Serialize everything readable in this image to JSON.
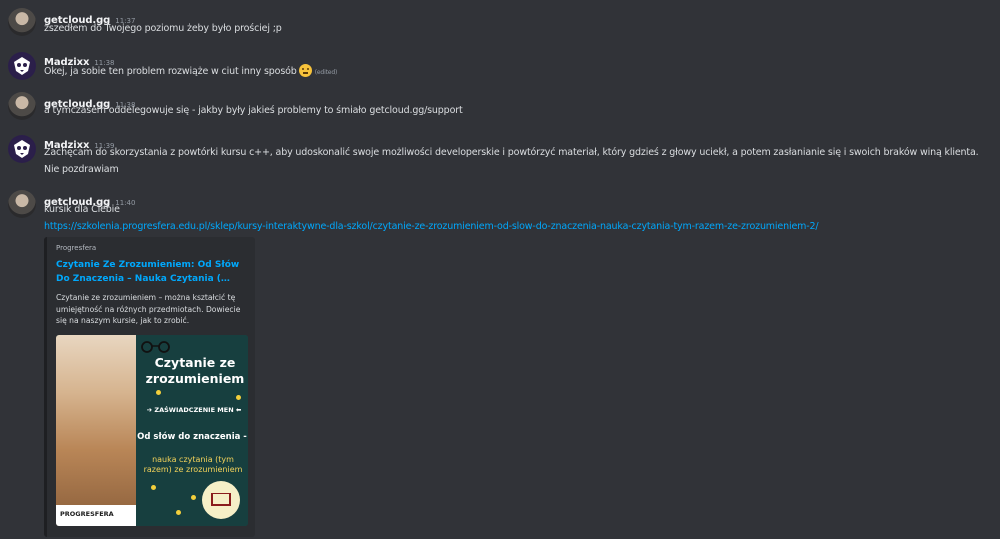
{
  "messages": [
    {
      "user": "getcloud.gg",
      "time": "11:37",
      "lines": [
        "zszedłem do Twojego poziomu żeby było prościej ;p"
      ]
    },
    {
      "user": "Madzixx",
      "time": "11:38",
      "lines": [
        "Okej, ja sobie ten problem rozwiąże w ciut inny sposób"
      ],
      "edited": "(edited)"
    },
    {
      "user": "getcloud.gg",
      "time": "11:38",
      "lines": [
        "a tymczasem oddelegowuje się - jakby były jakieś problemy to śmiało getcloud.gg/support"
      ]
    },
    {
      "user": "Madzixx",
      "time": "11:39",
      "lines": [
        "Zachęcam do skorzystania z powtórki kursu c++, aby udoskonalić swoje możliwości developerskie i powtórzyć materiał, który gdzieś z głowy uciekł, a potem zasłanianie się i swoich braków winą klienta.",
        "Nie pozdrawiam"
      ]
    },
    {
      "user": "getcloud.gg",
      "time": "11:40",
      "lines": [
        "kursik dla Ciebie"
      ],
      "link": "https://szkolenia.progresfera.edu.pl/sklep/kursy-interaktywne-dla-szkol/czytanie-ze-zrozumieniem-od-slow-do-znaczenia-nauka-czytania-tym-razem-ze-zrozumieniem-2/"
    }
  ],
  "embed": {
    "provider": "Progresfera",
    "title": "Czytanie Ze Zrozumieniem: Od Słów Do Znaczenia – Nauka Czytania (…",
    "description": "Czytanie ze zrozumieniem – można kształcić tę umiejętność na różnych przedmiotach. Dowiecie się na naszym kursie, jak to zrobić.",
    "thumbnail": {
      "title": "Czytanie ze zrozumieniem",
      "badge": "ZAŚWIADCZENIE MEN",
      "subtitle": "Od słów do znaczenia -",
      "subtitle2": "nauka czytania (tym razem) ze zrozumieniem",
      "logo": "PROGRESFERA"
    }
  },
  "colors": {
    "background": "#313338",
    "link": "#00a8fc",
    "embed_bg": "#2b2d31"
  }
}
